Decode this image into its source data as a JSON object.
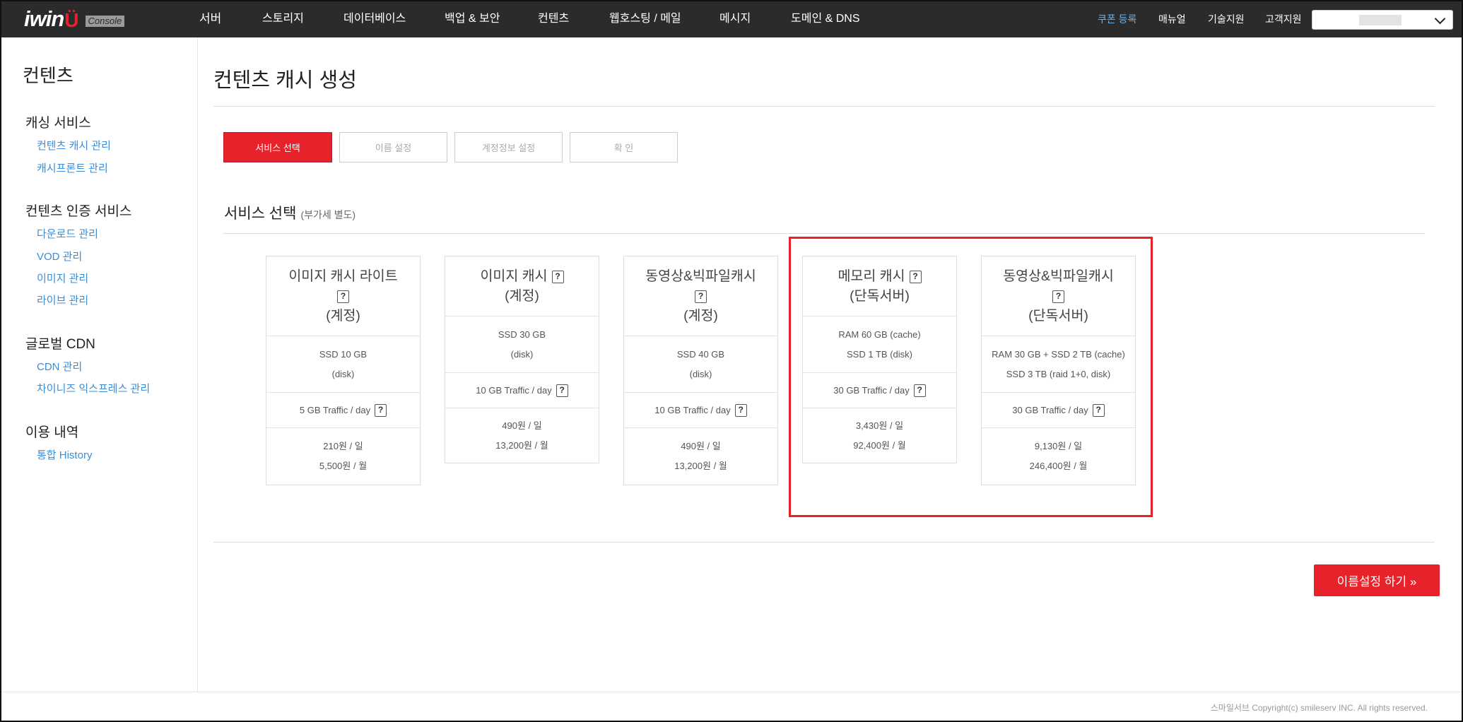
{
  "header": {
    "logo_text": "iwin",
    "logo_mark": "Ü",
    "console_label": "Console",
    "nav": [
      "서버",
      "스토리지",
      "데이터베이스",
      "백업 & 보안",
      "컨텐츠",
      "웹호스팅 / 메일",
      "메시지",
      "도메인 & DNS"
    ],
    "utility": [
      "쿠폰 등록",
      "매뉴얼",
      "기술지원",
      "고객지원"
    ],
    "account_select_value": ""
  },
  "sidebar": {
    "title": "컨텐츠",
    "sections": [
      {
        "title": "캐싱 서비스",
        "items": [
          "컨텐츠 캐시 관리",
          "캐시프론트 관리"
        ]
      },
      {
        "title": "컨텐츠 인증 서비스",
        "items": [
          "다운로드 관리",
          "VOD 관리",
          "이미지 관리",
          "라이브 관리"
        ]
      },
      {
        "title": "글로벌 CDN",
        "items": [
          "CDN 관리",
          "차이니즈 익스프레스 관리"
        ]
      },
      {
        "title": "이용 내역",
        "items": [
          "통합 History"
        ]
      }
    ]
  },
  "main": {
    "page_title": "컨텐츠 캐시 생성",
    "steps": [
      "서비스 선택",
      "이름 설정",
      "계정정보 설정",
      "확  인"
    ],
    "active_step": 0,
    "section_title": "서비스 선택",
    "section_note": "(부가세 별도)",
    "cards": [
      {
        "name": "이미지 캐시 라이트",
        "type": "(계정)",
        "spec": [
          "SSD 10 GB",
          "(disk)"
        ],
        "traffic": "5 GB Traffic / day",
        "price": [
          "210원 / 일",
          "5,500원 / 월"
        ]
      },
      {
        "name": "이미지 캐시",
        "type": "(계정)",
        "spec": [
          "SSD 30 GB",
          "(disk)"
        ],
        "traffic": "10 GB Traffic / day",
        "price": [
          "490원 / 일",
          "13,200원 / 월"
        ]
      },
      {
        "name": "동영상&빅파일캐시",
        "type": "(계정)",
        "spec": [
          "SSD 40 GB",
          "(disk)"
        ],
        "traffic": "10 GB Traffic / day",
        "price": [
          "490원 / 일",
          "13,200원 / 월"
        ]
      },
      {
        "name": "메모리 캐시",
        "type": "(단독서버)",
        "spec": [
          "RAM 60 GB (cache)",
          "SSD 1 TB (disk)"
        ],
        "traffic": "30 GB Traffic / day",
        "price": [
          "3,430원 / 일",
          "92,400원 / 월"
        ]
      },
      {
        "name": "동영상&빅파일캐시",
        "type": "(단독서버)",
        "spec": [
          "RAM 30 GB + SSD 2 TB (cache)",
          "SSD 3 TB (raid 1+0, disk)"
        ],
        "traffic": "30 GB Traffic / day",
        "price": [
          "9,130원 / 일",
          "246,400원 / 월"
        ]
      }
    ],
    "help_icon_text": "?",
    "next_button": "이름설정 하기 »"
  },
  "footer": {
    "copyright": "스마일서브 Copyright(c) smileserv INC. All rights reserved."
  },
  "colors": {
    "accent": "#e8222a",
    "topbar": "#2b2b2b",
    "link": "#3b8cd6",
    "coupon": "#6ab0ea"
  }
}
